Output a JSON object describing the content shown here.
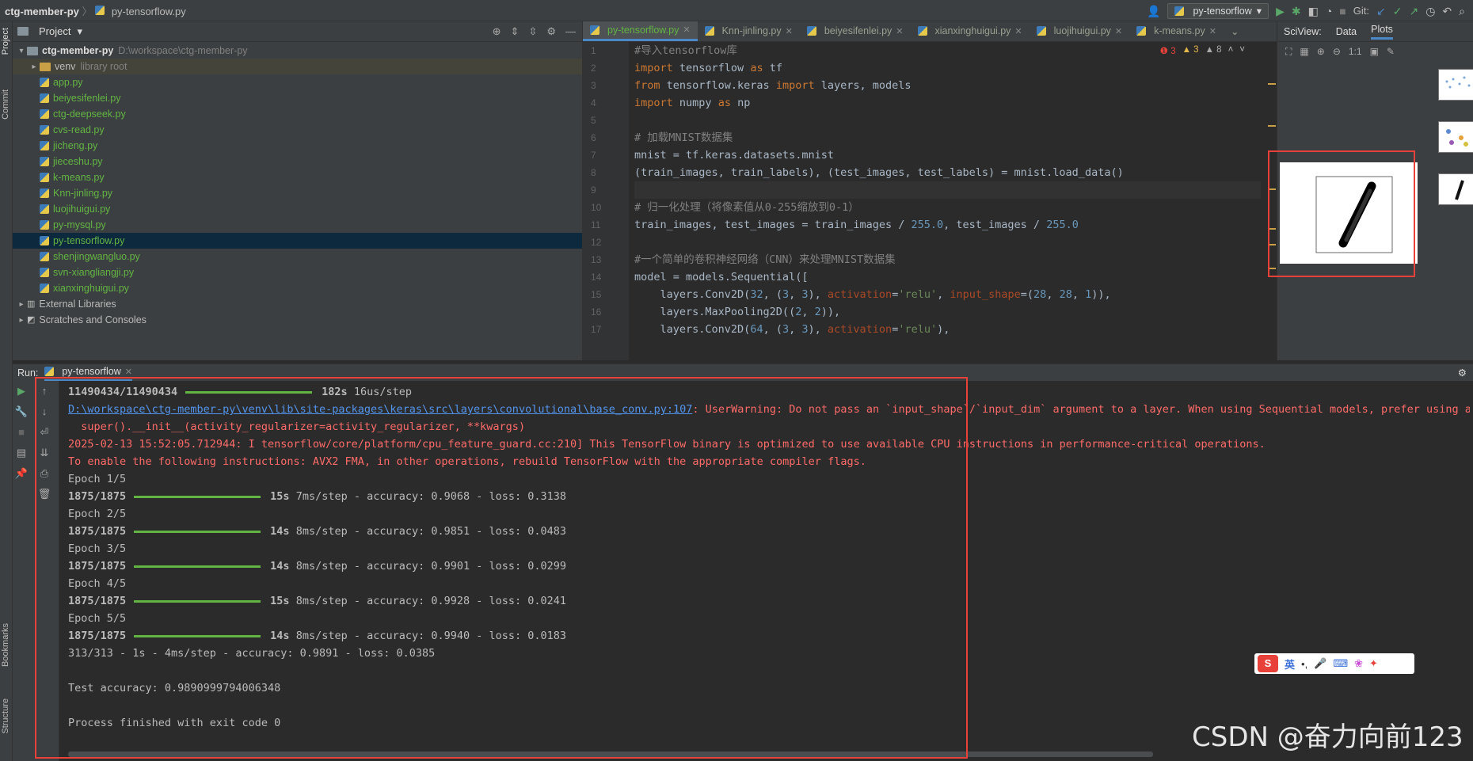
{
  "title_bar": {
    "project": "ctg-member-py",
    "file": "py-tensorflow.py",
    "run_config": "py-tensorflow",
    "git_label": "Git:"
  },
  "left_strip": {
    "project_label": "Project",
    "commit_label": "Commit",
    "bookmarks_label": "Bookmarks",
    "structure_label": "Structure"
  },
  "project_panel": {
    "title": "Project",
    "root": {
      "name": "ctg-member-py",
      "path": "D:\\workspace\\ctg-member-py"
    },
    "venv": {
      "name": "venv",
      "note": "library root"
    },
    "files": [
      "app.py",
      "beiyesifenlei.py",
      "ctg-deepseek.py",
      "cvs-read.py",
      "jicheng.py",
      "jieceshu.py",
      "k-means.py",
      "Knn-jinling.py",
      "luojihuigui.py",
      "py-mysql.py",
      "py-tensorflow.py",
      "shenjingwangluo.py",
      "svn-xiangliangji.py",
      "xianxinghuigui.py"
    ],
    "selected_file": "py-tensorflow.py",
    "external": "External Libraries",
    "scratches": "Scratches and Consoles"
  },
  "editor": {
    "tabs": [
      "py-tensorflow.py",
      "Knn-jinling.py",
      "beiyesifenlei.py",
      "xianxinghuigui.py",
      "luojihuigui.py",
      "k-means.py"
    ],
    "active_tab": "py-tensorflow.py",
    "inspections": {
      "errors": "3",
      "warnings": "3",
      "weak": "8"
    },
    "line_numbers": [
      "1",
      "2",
      "3",
      "4",
      "5",
      "6",
      "7",
      "8",
      "9",
      "10",
      "11",
      "12",
      "13",
      "14",
      "15",
      "16",
      "17"
    ],
    "lines": [
      "#导入tensorflow库",
      "import tensorflow as tf",
      "from tensorflow.keras import layers, models",
      "import numpy as np",
      "",
      "# 加载MNIST数据集",
      "mnist = tf.keras.datasets.mnist",
      "(train_images, train_labels), (test_images, test_labels) = mnist.load_data()",
      "",
      "# 归一化处理（将像素值从0-255缩放到0-1）",
      "train_images, test_images = train_images / 255.0, test_images / 255.0",
      "",
      "#一个简单的卷积神经网络（CNN）来处理MNIST数据集",
      "model = models.Sequential([",
      "    layers.Conv2D(32, (3, 3), activation='relu', input_shape=(28, 28, 1)),",
      "    layers.MaxPooling2D((2, 2)),",
      "    layers.Conv2D(64, (3, 3), activation='relu'),"
    ]
  },
  "sciview": {
    "label": "SciView:",
    "tabs": [
      "Data",
      "Plots"
    ],
    "active": "Plots",
    "zoom": "1:1"
  },
  "run": {
    "label": "Run:",
    "tab": "py-tensorflow",
    "console": {
      "download": {
        "count": "11490434/11490434",
        "time": "182s",
        "rate": "16us/step"
      },
      "warning_path": "D:\\workspace\\ctg-member-py\\venv\\lib\\site-packages\\keras\\src\\layers\\convolutional\\base_conv.py:107",
      "warning_msg": ": UserWarning: Do not pass an `input_shape`/`input_dim` argument to a layer. When using Sequential models, prefer using an `I",
      "warning_cont": "  super().__init__(activity_regularizer=activity_regularizer, **kwargs)",
      "tf_info_1": "2025-02-13 15:52:05.712944: I tensorflow/core/platform/cpu_feature_guard.cc:210] This TensorFlow binary is optimized to use available CPU instructions in performance-critical operations.",
      "tf_info_2": "To enable the following instructions: AVX2 FMA, in other operations, rebuild TensorFlow with the appropriate compiler flags.",
      "epochs": [
        {
          "label": "Epoch 1/5",
          "steps": "1875/1875",
          "time": "15s",
          "rest": "7ms/step - accuracy: 0.9068 - loss: 0.3138"
        },
        {
          "label": "Epoch 2/5",
          "steps": "1875/1875",
          "time": "14s",
          "rest": "8ms/step - accuracy: 0.9851 - loss: 0.0483"
        },
        {
          "label": "Epoch 3/5",
          "steps": "1875/1875",
          "time": "14s",
          "rest": "8ms/step - accuracy: 0.9901 - loss: 0.0299"
        },
        {
          "label": "Epoch 4/5",
          "steps": "1875/1875",
          "time": "15s",
          "rest": "8ms/step - accuracy: 0.9928 - loss: 0.0241"
        },
        {
          "label": "Epoch 5/5",
          "steps": "1875/1875",
          "time": "14s",
          "rest": "8ms/step - accuracy: 0.9940 - loss: 0.0183"
        }
      ],
      "eval": "313/313 - 1s - 4ms/step - accuracy: 0.9891 - loss: 0.0385",
      "test_acc": "Test accuracy: 0.9890999794006348",
      "finished": "Process finished with exit code 0"
    }
  },
  "ime": {
    "lang": "英",
    "punct": "•,"
  },
  "watermark": "CSDN @奋力向前123",
  "colors": {
    "accent": "#4a88c7",
    "highlight_frame": "#e8413a",
    "progress": "#62b543",
    "error_text": "#ff6b68"
  }
}
